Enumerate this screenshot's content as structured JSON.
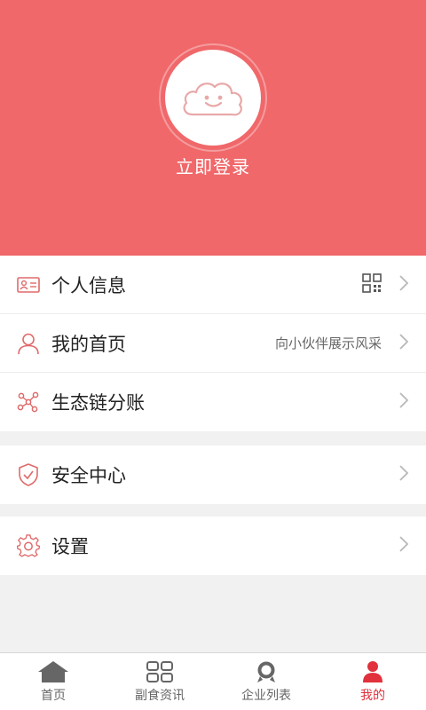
{
  "header": {
    "login_label": "立即登录"
  },
  "menu": {
    "group1": [
      {
        "label": "个人信息",
        "note": ""
      },
      {
        "label": "我的首页",
        "note": "向小伙伴展示风采"
      },
      {
        "label": "生态链分账",
        "note": ""
      }
    ],
    "group2": [
      {
        "label": "安全中心"
      }
    ],
    "group3": [
      {
        "label": "设置"
      }
    ]
  },
  "tabs": [
    {
      "label": "首页",
      "icon": "home-icon",
      "active": false
    },
    {
      "label": "副食资讯",
      "icon": "grid-icon",
      "active": false
    },
    {
      "label": "企业列表",
      "icon": "award-icon",
      "active": false
    },
    {
      "label": "我的",
      "icon": "user-icon",
      "active": true
    }
  ],
  "colors": {
    "primary": "#f0686a",
    "active_tab": "#e0313c",
    "icon_stroke": "#e06a6a"
  }
}
